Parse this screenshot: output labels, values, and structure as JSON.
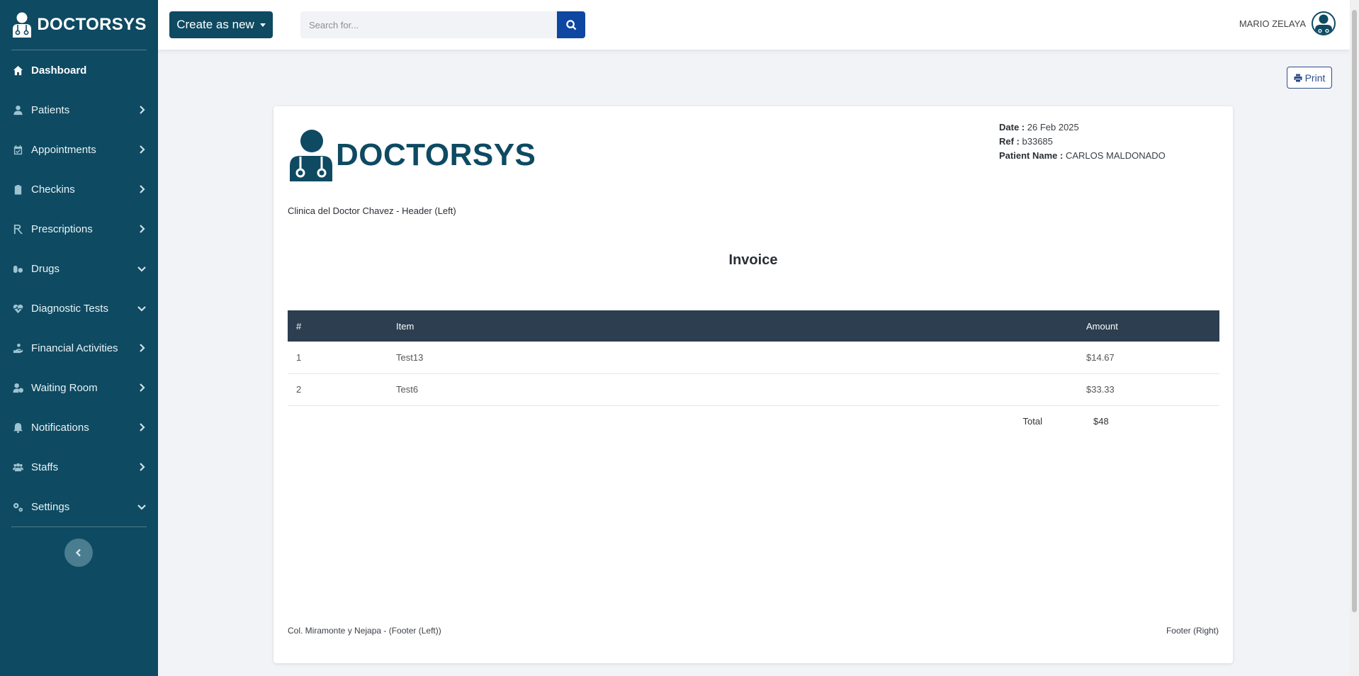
{
  "sidebar": {
    "brand": "DOCTORSYS",
    "items": [
      {
        "label": "Dashboard",
        "icon": "home-icon",
        "chevron": "none"
      },
      {
        "label": "Patients",
        "icon": "user-icon",
        "chevron": "right"
      },
      {
        "label": "Appointments",
        "icon": "calendar-icon",
        "chevron": "right"
      },
      {
        "label": "Checkins",
        "icon": "clipboard-icon",
        "chevron": "right"
      },
      {
        "label": "Prescriptions",
        "icon": "rx-icon",
        "chevron": "right"
      },
      {
        "label": "Drugs",
        "icon": "pills-icon",
        "chevron": "down"
      },
      {
        "label": "Diagnostic Tests",
        "icon": "heart-pulse-icon",
        "chevron": "down"
      },
      {
        "label": "Financial Activities",
        "icon": "hand-coin-icon",
        "chevron": "right"
      },
      {
        "label": "Waiting Room",
        "icon": "user-clock-icon",
        "chevron": "right"
      },
      {
        "label": "Notifications",
        "icon": "bell-icon",
        "chevron": "right"
      },
      {
        "label": "Staffs",
        "icon": "users-icon",
        "chevron": "right"
      },
      {
        "label": "Settings",
        "icon": "cogs-icon",
        "chevron": "down"
      }
    ]
  },
  "topbar": {
    "create_label": "Create as new",
    "search_placeholder": "Search for...",
    "user_name": "MARIO ZELAYA"
  },
  "print_label": "Print",
  "invoice": {
    "brand": "DOCTORSYS",
    "date_label": "Date :",
    "date_value": "26 Feb 2025",
    "ref_label": "Ref :",
    "ref_value": "b33685",
    "patient_label": "Patient Name :",
    "patient_value": "CARLOS MALDONADO",
    "header_text": "Clinica del Doctor Chavez - Header (Left)",
    "title": "Invoice",
    "columns": [
      "#",
      "Item",
      "Amount"
    ],
    "rows": [
      {
        "num": "1",
        "item": "Test13",
        "amount": "$14.67"
      },
      {
        "num": "2",
        "item": "Test6",
        "amount": "$33.33"
      }
    ],
    "total_label": "Total",
    "total_value": "$48",
    "footer_left": "Col. Miramonte y Nejapa - (Footer (Left))",
    "footer_right": "Footer (Right)"
  },
  "colors": {
    "sidebar_bg": "#0e4a62",
    "search_btn": "#0d47a1",
    "table_header": "#2c3e50",
    "print_accent": "#2e4d8a"
  }
}
